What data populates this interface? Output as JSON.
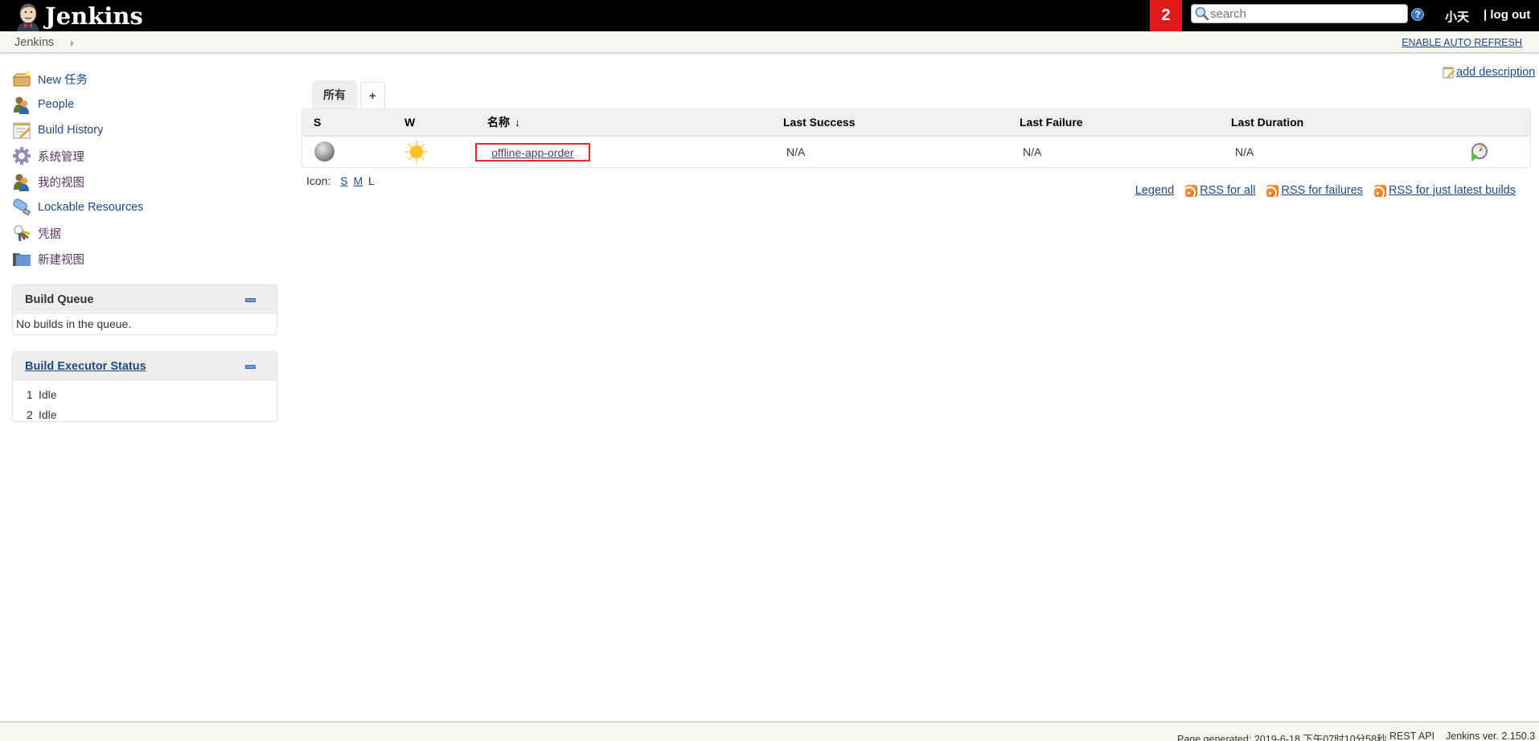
{
  "header": {
    "logo_text": "Jenkins",
    "notification_count": "2",
    "search_placeholder": "search",
    "help_label": "?",
    "user_name": "小天",
    "logout_label": "| log out"
  },
  "breadcrumb": {
    "items": [
      "Jenkins"
    ],
    "auto_refresh_label": "ENABLE AUTO REFRESH"
  },
  "sidebar": {
    "tasks": [
      {
        "label": "New 任务",
        "icon": "new-item-icon"
      },
      {
        "label": "People",
        "icon": "people-icon"
      },
      {
        "label": "Build History",
        "icon": "build-history-icon"
      },
      {
        "label": "系统管理",
        "icon": "gear-icon"
      },
      {
        "label": "我的视图",
        "icon": "user-icon"
      },
      {
        "label": "Lockable Resources",
        "icon": "usb-drive-icon"
      },
      {
        "label": "凭据",
        "icon": "credentials-key-icon"
      },
      {
        "label": "新建视图",
        "icon": "folder-icon"
      }
    ],
    "build_queue": {
      "title": "Build Queue",
      "empty_message": "No builds in the queue."
    },
    "executors": {
      "title": "Build Executor Status",
      "items": [
        {
          "number": "1",
          "status": "Idle"
        },
        {
          "number": "2",
          "status": "Idle"
        }
      ]
    }
  },
  "main": {
    "add_description_label": "add description",
    "tabs": [
      {
        "label": "所有",
        "active": true
      },
      {
        "label": "+",
        "active": false
      }
    ],
    "table": {
      "columns": [
        "S",
        "W",
        "名称",
        "Last Success",
        "Last Failure",
        "Last Duration"
      ],
      "sort_indicator": "↓",
      "rows": [
        {
          "status": "not-built",
          "weather": "sunny",
          "name": "offline-app-order",
          "last_success": "N/A",
          "last_failure": "N/A",
          "last_duration": "N/A"
        }
      ]
    },
    "icon_size": {
      "label": "Icon:",
      "options": [
        "S",
        "M",
        "L"
      ],
      "selected": "L"
    },
    "feeds": {
      "legend_label": "Legend",
      "links": [
        "RSS for all",
        "RSS for failures",
        "RSS for just latest builds"
      ]
    }
  },
  "footer": {
    "page_generated": "Page generated: 2019-6-18 下午07时10分58秒",
    "rest_api_label": "REST API",
    "version": "Jenkins ver. 2.150.3"
  },
  "colors": {
    "header_bg": "#000000",
    "badge_bg": "#e01b1b",
    "link": "#204a87",
    "visited_link": "#5c3566",
    "highlight_box": "#e8262a"
  }
}
